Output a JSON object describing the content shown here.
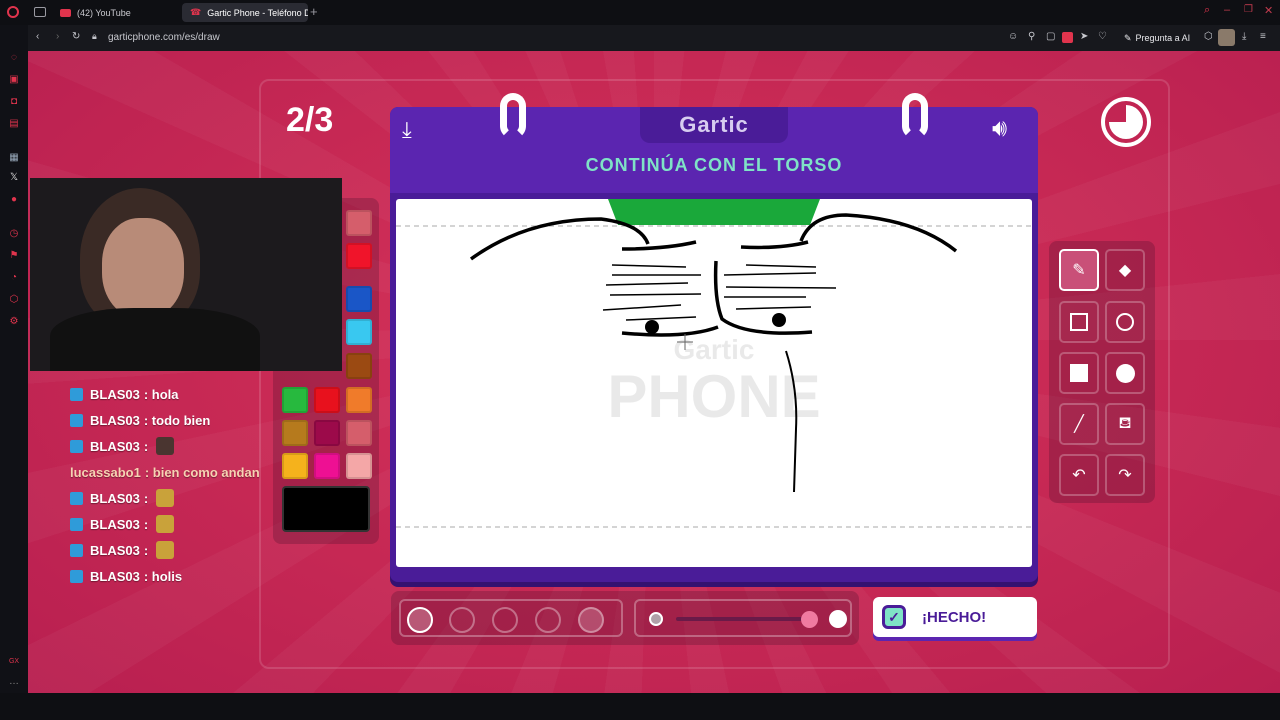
{
  "browser": {
    "tabs": [
      {
        "label": "(42) YouTube",
        "icon": "youtube-icon"
      },
      {
        "label": "Gartic Phone - Teléfono D",
        "icon": "gartic-icon"
      }
    ],
    "url": "garticphone.com/es/draw",
    "ai_button": "Pregunta a AI"
  },
  "game": {
    "round": "2/3",
    "logo": "Gartic",
    "prompt": "CONTINÚA CON EL TORSO",
    "watermark_top": "Gartic",
    "watermark_bottom": "PHONE",
    "done_label": "¡HECHO!",
    "timer_remaining": 0.75
  },
  "palette": {
    "colors": [
      "#d55e6b",
      "#f0142a",
      "#1a56c7",
      "#39c8f0",
      "#9b4a12",
      "#27b93e",
      "#e8111d",
      "#f07b2a",
      "#b67a1d",
      "#9c0a4a",
      "#d55e6b",
      "#f5b21c",
      "#ee1093",
      "#f4a7a7"
    ],
    "selected": "#000000"
  },
  "tools": [
    "pencil-icon",
    "eraser-icon",
    "rectangle-outline-icon",
    "circle-outline-icon",
    "rectangle-filled-icon",
    "circle-filled-icon",
    "line-icon",
    "fill-bucket-icon",
    "undo-icon",
    "redo-icon"
  ],
  "chat": [
    {
      "user": "BLAS03",
      "text": ": hola",
      "badge": true
    },
    {
      "user": "BLAS03",
      "text": ": todo bien",
      "badge": true
    },
    {
      "user": "BLAS03",
      "text": ":",
      "badge": true,
      "emote": "face-emote"
    },
    {
      "user": "lucassabo1",
      "text": ": bien como andan",
      "badge": false
    },
    {
      "user": "BLAS03",
      "text": ":",
      "badge": true,
      "emote": "dance-emote"
    },
    {
      "user": "BLAS03",
      "text": ":",
      "badge": true,
      "emote": "dance-emote"
    },
    {
      "user": "BLAS03",
      "text": ":",
      "badge": true,
      "emote": "dance-emote"
    },
    {
      "user": "BLAS03",
      "text": ": holis",
      "badge": true
    }
  ]
}
